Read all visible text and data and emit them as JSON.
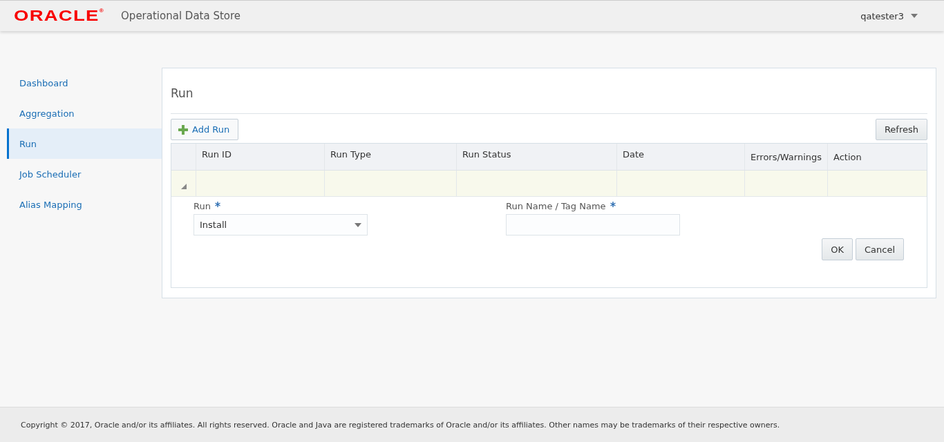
{
  "header": {
    "logo": "ORACLE",
    "logo_mark": "®",
    "app_title": "Operational Data Store",
    "user": "qatester3"
  },
  "sidebar": {
    "items": [
      {
        "label": "Dashboard",
        "selected": false
      },
      {
        "label": "Aggregation",
        "selected": false
      },
      {
        "label": "Run",
        "selected": true
      },
      {
        "label": "Job Scheduler",
        "selected": false
      },
      {
        "label": "Alias Mapping",
        "selected": false
      }
    ]
  },
  "panel": {
    "title": "Run",
    "toolbar": {
      "add_button": "Add Run",
      "refresh_button": "Refresh"
    },
    "table": {
      "columns": [
        "Run ID",
        "Run Type",
        "Run Status",
        "Date",
        "Errors/Warnings",
        "Action"
      ],
      "new_row": {
        "expanded": true
      }
    },
    "form": {
      "fields": [
        {
          "kind": "select",
          "label": "Run",
          "required": true,
          "value": "Install"
        },
        {
          "kind": "text",
          "label": "Run Name / Tag Name",
          "required": true
        }
      ],
      "buttons": [
        "OK",
        "Cancel"
      ]
    }
  },
  "footer": {
    "text": "Copyright © 2017, Oracle and/or its affiliates. All rights reserved. Oracle and Java are registered trademarks of Oracle and/or its affiliates. Other names may be trademarks of their respective owners."
  }
}
